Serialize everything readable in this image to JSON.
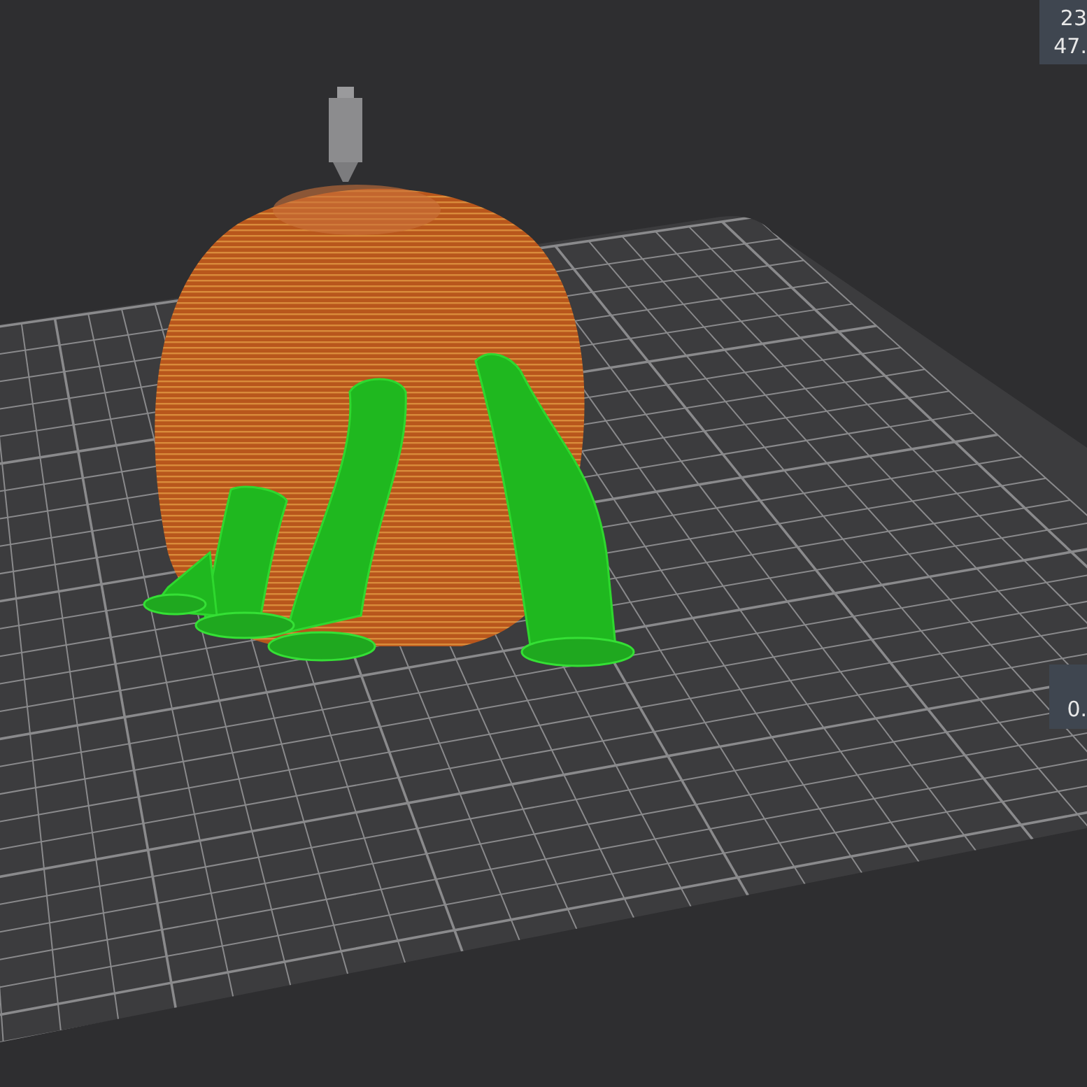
{
  "readouts": [
    {
      "lines": [
        "23",
        "47."
      ]
    },
    {
      "lines": [
        "0."
      ]
    }
  ]
}
